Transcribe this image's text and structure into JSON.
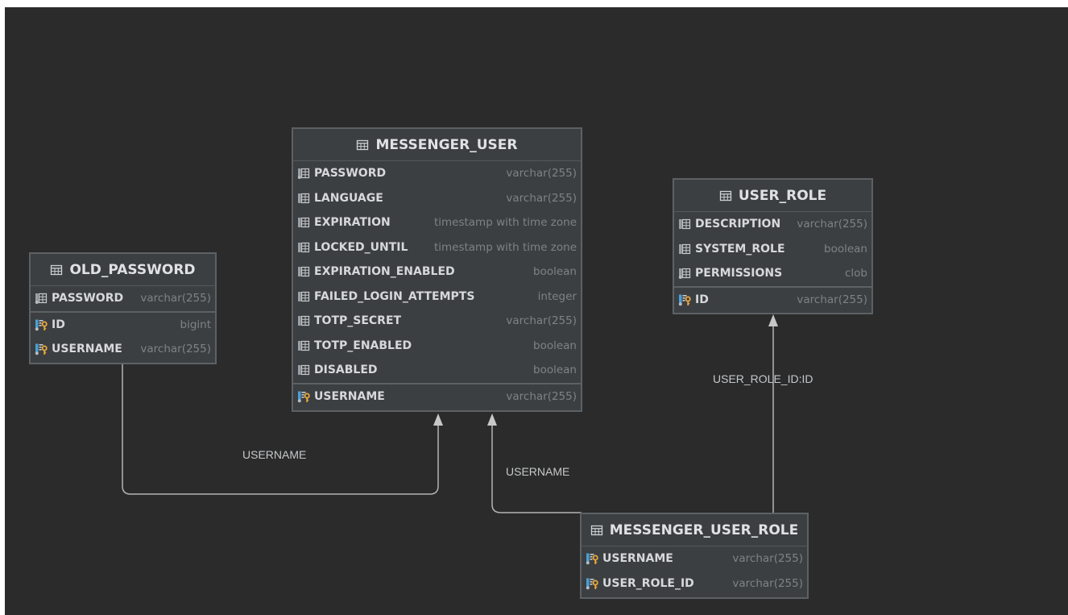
{
  "tables": {
    "messenger_user": {
      "title": "MESSENGER_USER",
      "columns": [
        {
          "name": "PASSWORD",
          "type": "varchar(255)",
          "icon": "column-fk-icon"
        },
        {
          "name": "LANGUAGE",
          "type": "varchar(255)",
          "icon": "column-icon"
        },
        {
          "name": "EXPIRATION",
          "type": "timestamp with time zone",
          "icon": "column-icon"
        },
        {
          "name": "LOCKED_UNTIL",
          "type": "timestamp with time zone",
          "icon": "column-icon"
        },
        {
          "name": "EXPIRATION_ENABLED",
          "type": "boolean",
          "icon": "column-icon"
        },
        {
          "name": "FAILED_LOGIN_ATTEMPTS",
          "type": "integer",
          "icon": "column-icon"
        },
        {
          "name": "TOTP_SECRET",
          "type": "varchar(255)",
          "icon": "column-icon"
        },
        {
          "name": "TOTP_ENABLED",
          "type": "boolean",
          "icon": "column-icon"
        },
        {
          "name": "DISABLED",
          "type": "boolean",
          "icon": "column-icon"
        }
      ],
      "keys": [
        {
          "name": "USERNAME",
          "type": "varchar(255)",
          "icon": "primary-key-icon"
        }
      ]
    },
    "user_role": {
      "title": "USER_ROLE",
      "columns": [
        {
          "name": "DESCRIPTION",
          "type": "varchar(255)",
          "icon": "column-icon"
        },
        {
          "name": "SYSTEM_ROLE",
          "type": "boolean",
          "icon": "column-icon"
        },
        {
          "name": "PERMISSIONS",
          "type": "clob",
          "icon": "column-fk-icon"
        }
      ],
      "keys": [
        {
          "name": "ID",
          "type": "varchar(255)",
          "icon": "primary-key-icon"
        }
      ]
    },
    "old_password": {
      "title": "OLD_PASSWORD",
      "columns": [
        {
          "name": "PASSWORD",
          "type": "varchar(255)",
          "icon": "column-fk-icon"
        }
      ],
      "keys": [
        {
          "name": "ID",
          "type": "bigint",
          "icon": "primary-key-icon"
        },
        {
          "name": "USERNAME",
          "type": "varchar(255)",
          "icon": "primary-key-icon"
        }
      ]
    },
    "messenger_user_role": {
      "title": "MESSENGER_USER_ROLE",
      "columns": [],
      "keys": [
        {
          "name": "USERNAME",
          "type": "varchar(255)",
          "icon": "primary-key-icon"
        },
        {
          "name": "USER_ROLE_ID",
          "type": "varchar(255)",
          "icon": "primary-key-icon"
        }
      ]
    }
  },
  "relations": {
    "old_password_to_user": "USERNAME",
    "user_role_link_to_user": "USERNAME",
    "user_role_link_to_role": "USER_ROLE_ID:ID"
  },
  "colors": {
    "canvas": "#2b2b2b",
    "table_bg": "#3c3f41",
    "border": "#5d6164",
    "connector": "#b4b4b4"
  }
}
